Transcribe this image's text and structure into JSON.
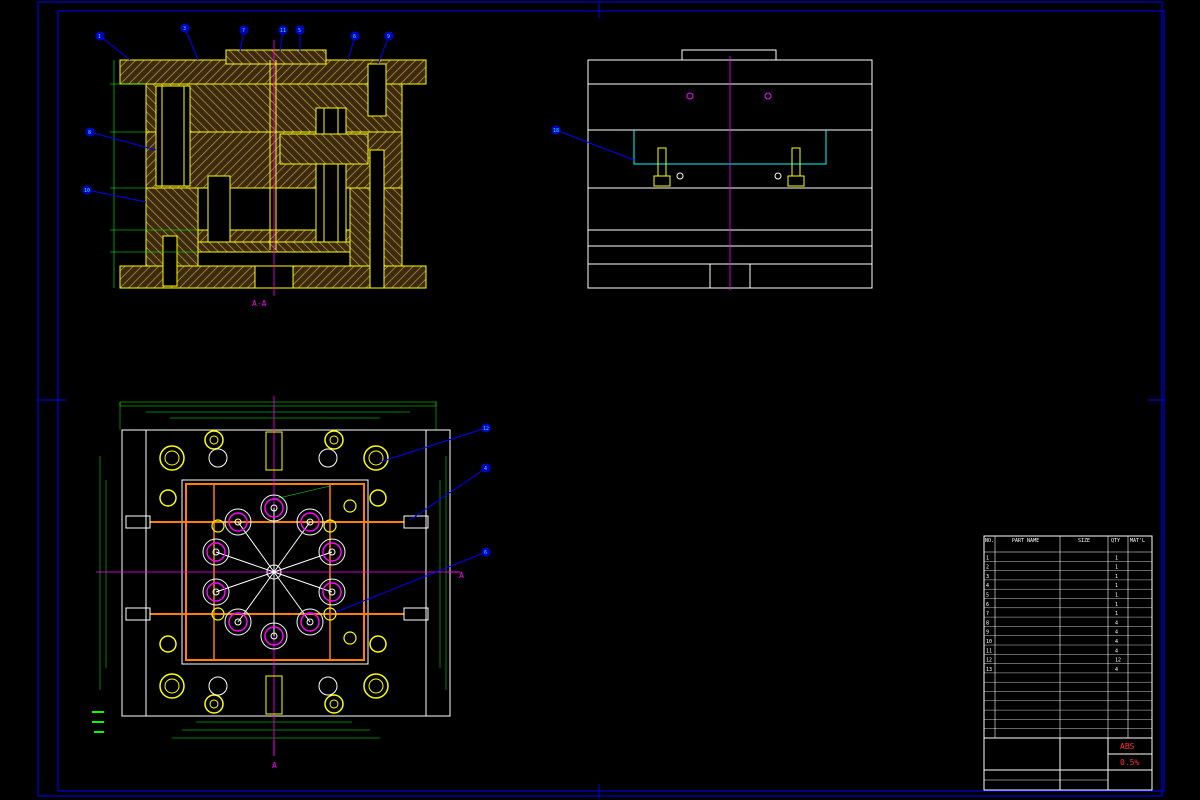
{
  "drawing": {
    "section_label": "A-A",
    "view_arrow_label": "A",
    "side_arrow_label": "A",
    "balloons_section": [
      "1",
      "3",
      "7",
      "11",
      "5",
      "6",
      "9",
      "8",
      "10"
    ],
    "balloon_side": "18",
    "balloons_plan": [
      "12",
      "4",
      "6"
    ]
  },
  "title_block": {
    "material": "ABS",
    "shrinkage": "0.5%",
    "drawing_title": "",
    "headers": {
      "no": "NO.",
      "part_name": "PART NAME",
      "size": "SIZE",
      "qty": "QTY",
      "matl": "MAT'L"
    },
    "rows": [
      {
        "no": "1",
        "name": "",
        "size": "",
        "qty": "1",
        "matl": ""
      },
      {
        "no": "2",
        "name": "",
        "size": "",
        "qty": "1",
        "matl": ""
      },
      {
        "no": "3",
        "name": "",
        "size": "",
        "qty": "1",
        "matl": ""
      },
      {
        "no": "4",
        "name": "",
        "size": "",
        "qty": "1",
        "matl": ""
      },
      {
        "no": "5",
        "name": "",
        "size": "",
        "qty": "1",
        "matl": ""
      },
      {
        "no": "6",
        "name": "",
        "size": "",
        "qty": "1",
        "matl": ""
      },
      {
        "no": "7",
        "name": "",
        "size": "",
        "qty": "1",
        "matl": ""
      },
      {
        "no": "8",
        "name": "",
        "size": "",
        "qty": "4",
        "matl": ""
      },
      {
        "no": "9",
        "name": "",
        "size": "",
        "qty": "4",
        "matl": ""
      },
      {
        "no": "10",
        "name": "",
        "size": "",
        "qty": "4",
        "matl": ""
      },
      {
        "no": "11",
        "name": "",
        "size": "",
        "qty": "4",
        "matl": ""
      },
      {
        "no": "12",
        "name": "",
        "size": "",
        "qty": "12",
        "matl": ""
      },
      {
        "no": "13",
        "name": "",
        "size": "",
        "qty": "4",
        "matl": ""
      }
    ]
  },
  "colors": {
    "frame": "#0000ff",
    "plates": "#ffff00",
    "hatch": "#8b6b2a",
    "center_line": "#ff00ff",
    "dimensions": "#00ff00",
    "cooling": "#ff8000",
    "outline": "#ffffff",
    "cavity": "#ff00ff",
    "balloon": "#00ffff"
  }
}
